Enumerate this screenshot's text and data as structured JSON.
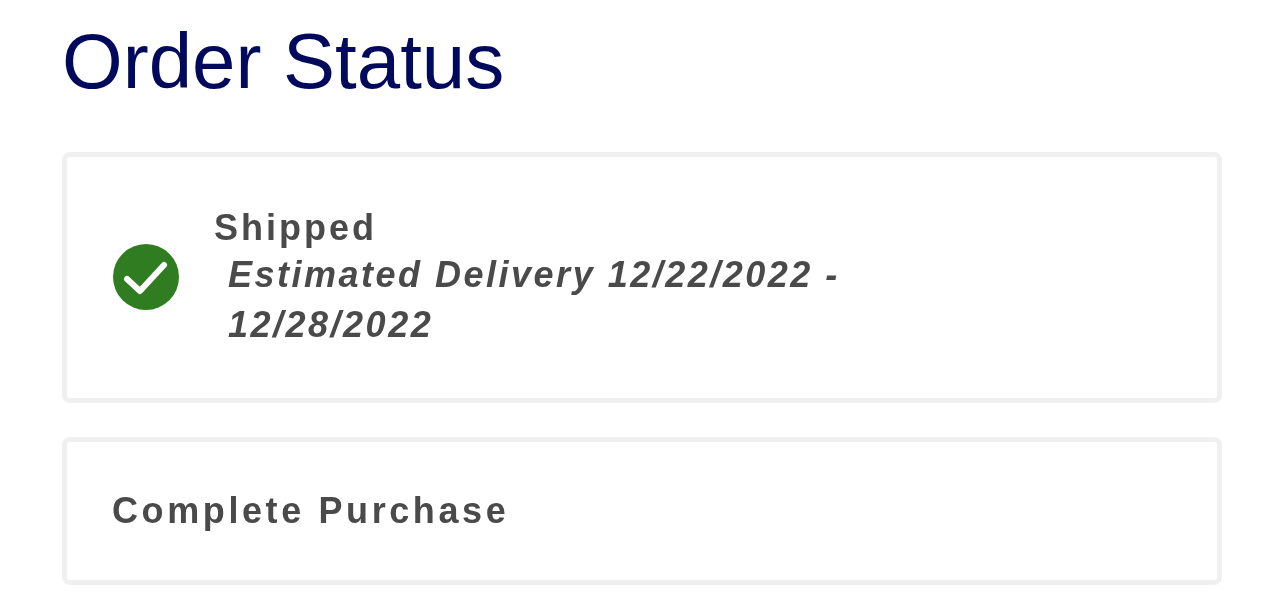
{
  "page": {
    "title": "Order Status"
  },
  "steps": [
    {
      "kind": "status",
      "completed": true,
      "title": "Shipped",
      "detail": "Estimated Delivery 12/22/2022 - 12/28/2022"
    },
    {
      "kind": "action",
      "title": "Complete Purchase"
    }
  ]
}
